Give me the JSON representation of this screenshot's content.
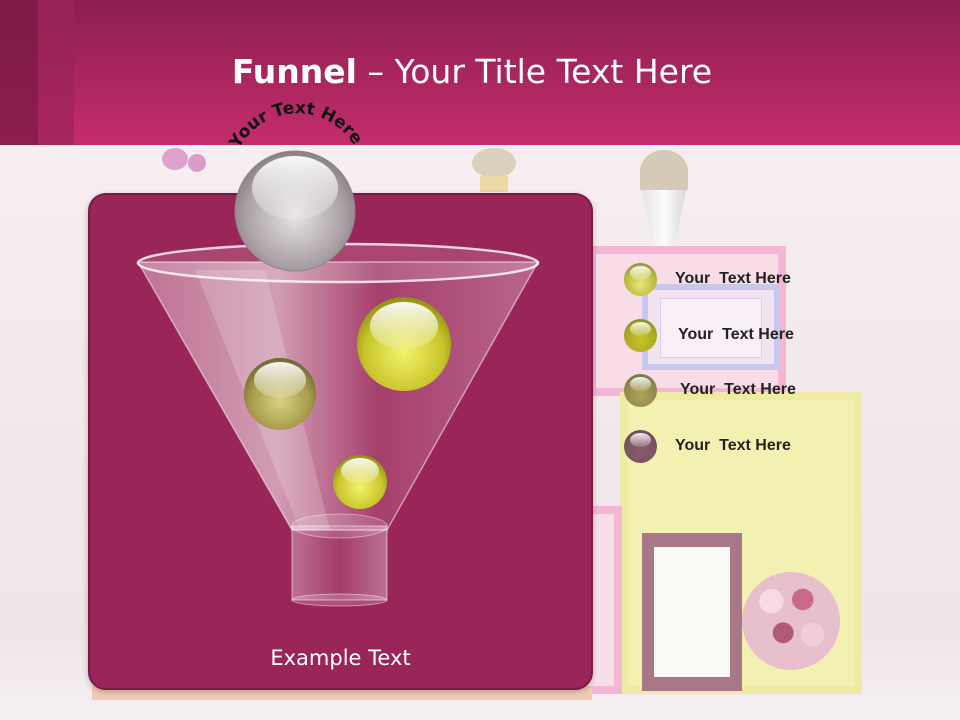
{
  "slide": {
    "title_bold": "Funnel",
    "title_rest": " – Your Title Text Here",
    "arc_text": "Your Text Here",
    "example_text": "Example Text"
  },
  "legend": [
    {
      "label": "Your  Text Here",
      "color": "#b8b63a"
    },
    {
      "label": "Your  Text Here",
      "color": "#aaa820"
    },
    {
      "label": "Your  Text Here",
      "color": "#8e8a4a"
    },
    {
      "label": "Your  Text Here",
      "color": "#7a5060"
    }
  ],
  "colors": {
    "header": "#c42d6c",
    "panel": "#9a2558",
    "ball_yellow": "#c9c83a",
    "ball_olive": "#a59a46",
    "ball_grey": "#b9b2b6"
  }
}
